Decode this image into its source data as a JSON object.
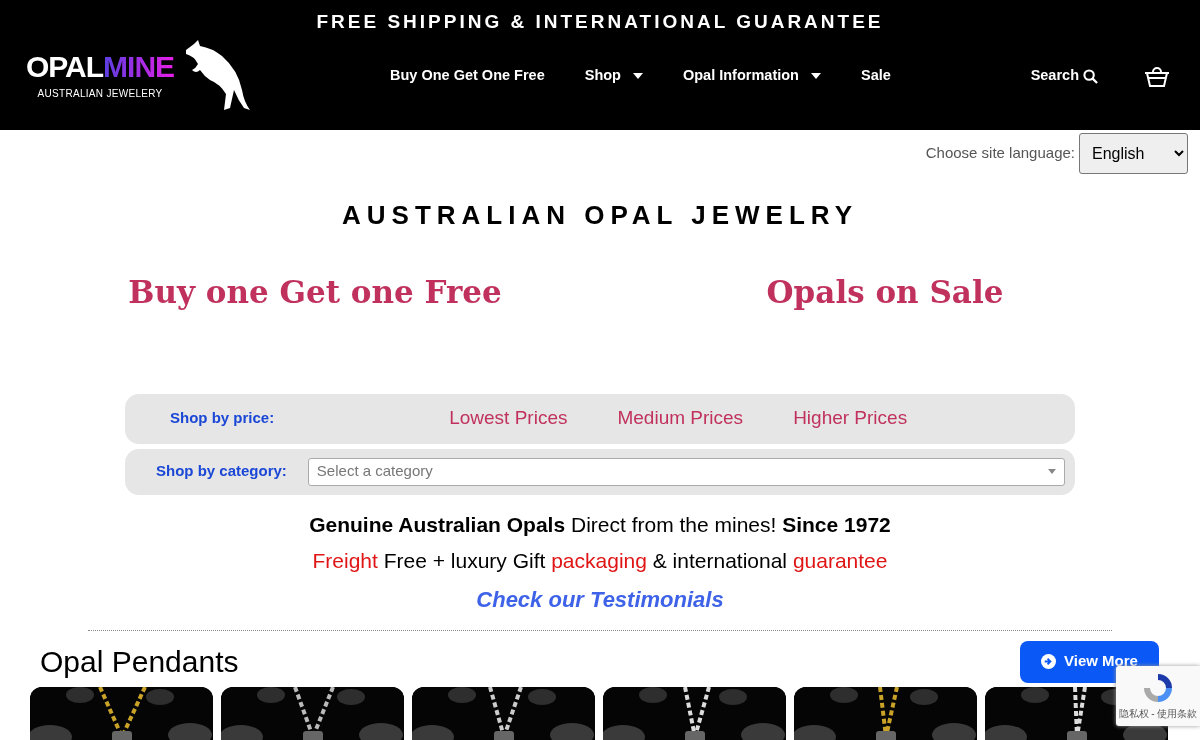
{
  "announcement": "FREE SHIPPING & INTERNATIONAL GUARANTEE",
  "logo": {
    "brand_a": "OPAL",
    "brand_b": "MINE",
    "tagline": "AUSTRALIAN JEWELERY"
  },
  "nav": [
    {
      "label": "Buy One Get One Free",
      "dropdown": false
    },
    {
      "label": "Shop",
      "dropdown": true
    },
    {
      "label": "Opal Information",
      "dropdown": true
    },
    {
      "label": "Sale",
      "dropdown": false
    }
  ],
  "search": {
    "label": "Search"
  },
  "language": {
    "label": "Choose site language:",
    "value": "English"
  },
  "heading": "AUSTRALIAN OPAL JEWELRY",
  "promos": [
    "Buy one Get one Free",
    "Opals on Sale"
  ],
  "price_bar": {
    "label": "Shop by price:",
    "links": [
      "Lowest Prices",
      "Medium Prices",
      "Higher Prices"
    ]
  },
  "category_bar": {
    "label": "Shop by category:",
    "placeholder": "Select a category"
  },
  "lines": [
    [
      {
        "text": "Genuine Australian Opals",
        "bold": true
      },
      {
        "text": " Direct from the mines! ",
        "bold": false
      },
      {
        "text": "Since 1972",
        "bold": true
      }
    ],
    [
      {
        "text": "Freight",
        "highlight": true
      },
      {
        "text": " Free + luxury Gift ",
        "highlight": false
      },
      {
        "text": "packaging",
        "highlight": true
      },
      {
        "text": " & international ",
        "highlight": false
      },
      {
        "text": "guarantee",
        "highlight": true
      }
    ]
  ],
  "testimonials_link": "Check our Testimonials",
  "section": {
    "title": "Opal Pendants",
    "button": "View More"
  },
  "recaptcha": {
    "links": "隐私权 - 使用条款"
  }
}
